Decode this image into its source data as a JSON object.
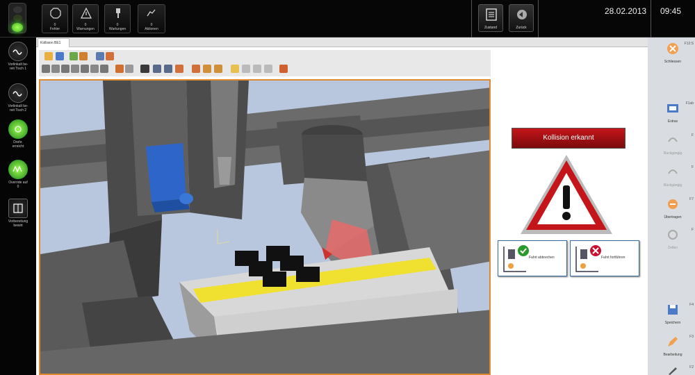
{
  "topbar": {
    "buttons": [
      {
        "icon": "stop-icon",
        "lines": [
          "0",
          "Fehler"
        ]
      },
      {
        "icon": "warning-icon",
        "lines": [
          "0",
          "Warnungen"
        ]
      },
      {
        "icon": "tool-icon",
        "lines": [
          "0",
          "Wartungen"
        ]
      },
      {
        "icon": "hand-icon",
        "lines": [
          "0",
          "Aktionen"
        ]
      }
    ],
    "right_buttons": [
      {
        "icon": "clipboard-icon",
        "label": "Zustand"
      },
      {
        "icon": "back-icon",
        "label": "Zurück"
      }
    ],
    "date": "28.02.2013",
    "time": "09:45"
  },
  "sidebar": {
    "items": [
      {
        "icon": "wave-icon",
        "lines": [
          "Vorlinkalt be-",
          "reit Tisch 1"
        ]
      },
      {
        "icon": "wave-icon",
        "lines": [
          "Vorlinkalt be-",
          "reit Tisch 2"
        ]
      },
      {
        "icon": "spindle-icon",
        "lines": [
          "Drehr.",
          "erreicht"
        ]
      },
      {
        "icon": "override-icon",
        "lines": [
          "Override auf",
          "0"
        ]
      },
      {
        "icon": "inspect-icon",
        "lines": [
          "Vorbereitung",
          "bewirt"
        ]
      }
    ]
  },
  "tab": {
    "label": "Kollision BE1"
  },
  "alert": {
    "title": "Kollision erkannt"
  },
  "choices": [
    {
      "label": "Fahrt abbrechen",
      "status": "ok"
    },
    {
      "label": "Fahrt fortführen",
      "status": "cancel"
    }
  ],
  "rightcol": {
    "items": [
      {
        "label": "Schliessen",
        "fkey": "F12:S",
        "enabled": true
      },
      {
        "label": "Extras",
        "fkey": "F1ab",
        "enabled": true
      },
      {
        "label": "Rückgängig",
        "fkey": "F",
        "enabled": false
      },
      {
        "label": "Rückgängig",
        "fkey": "F",
        "enabled": false
      },
      {
        "label": "Übertragen",
        "fkey": "F7",
        "enabled": true
      },
      {
        "label": "Zeiten",
        "fkey": "F",
        "enabled": false
      },
      {
        "label": "Speichern",
        "fkey": "F4",
        "enabled": true
      },
      {
        "label": "Bearbeitung",
        "fkey": "F3",
        "enabled": true
      },
      {
        "label": "",
        "fkey": "F2",
        "enabled": true
      }
    ]
  },
  "colors": {
    "accent_orange": "#e08a30",
    "alert_red": "#c4161a",
    "ok_green": "#2a9a2a",
    "cancel_red": "#c8102e"
  }
}
